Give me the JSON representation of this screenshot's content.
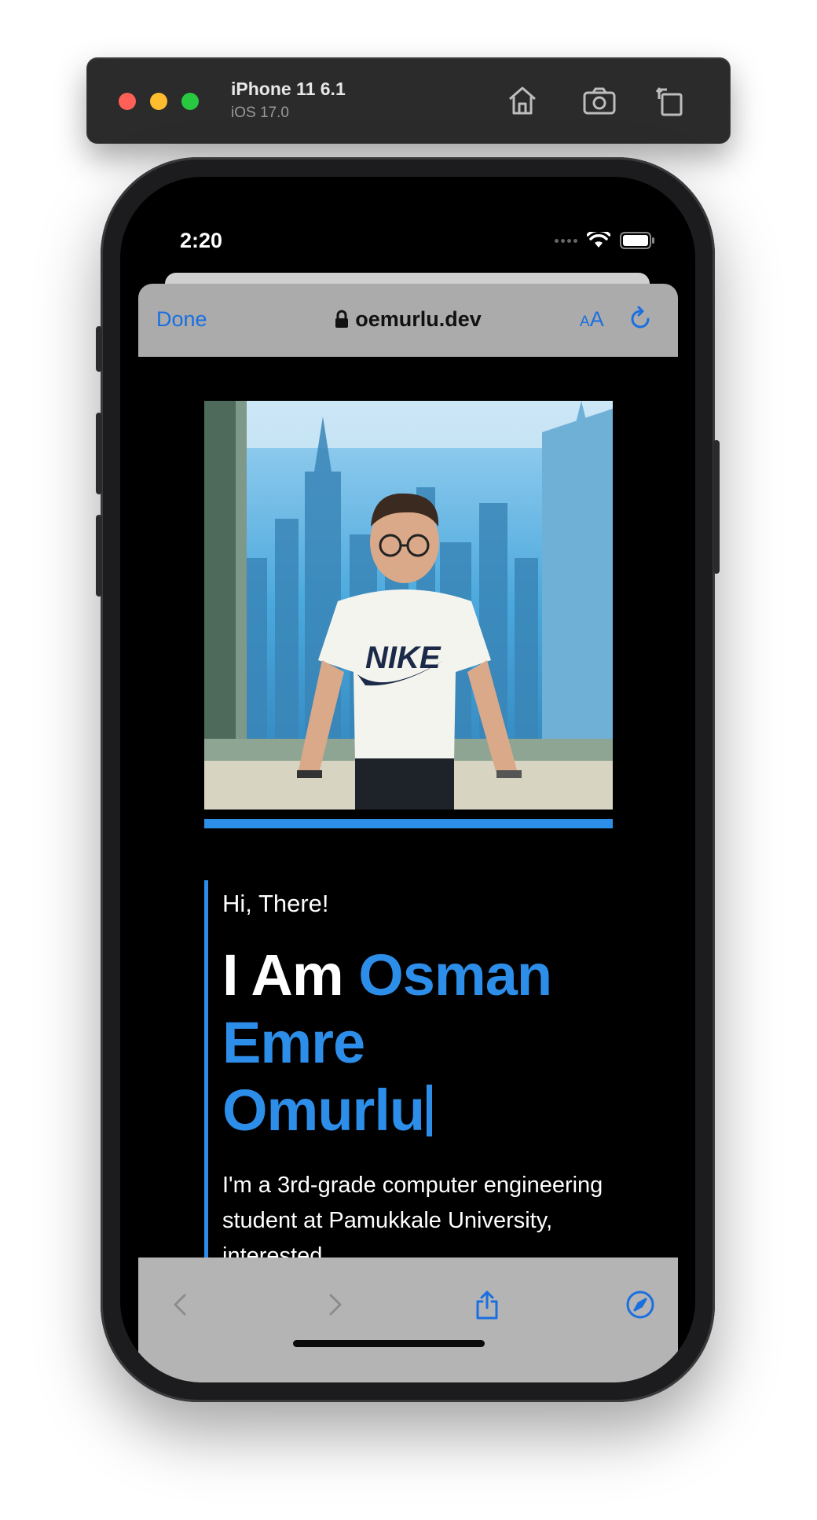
{
  "simulator": {
    "device_name": "iPhone 11 6.1",
    "os_version": "iOS 17.0",
    "toolbar_icons": [
      "home-icon",
      "screenshot-icon",
      "rotate-icon"
    ]
  },
  "status_bar": {
    "time": "2:20"
  },
  "safari": {
    "done_label": "Done",
    "url": "oemurlu.dev",
    "aa_small": "A",
    "aa_large": "A",
    "accent_color": "#1a6fe0"
  },
  "page": {
    "greeting": "Hi, There!",
    "heading_prefix": "I Am",
    "name_line1": "Osman",
    "name_line2": "Emre",
    "name_line3": "Omurlu",
    "bio": "I'm a 3rd-grade computer engineering student at Pamukkale University, interested",
    "accent_color": "#2d8ee9"
  }
}
